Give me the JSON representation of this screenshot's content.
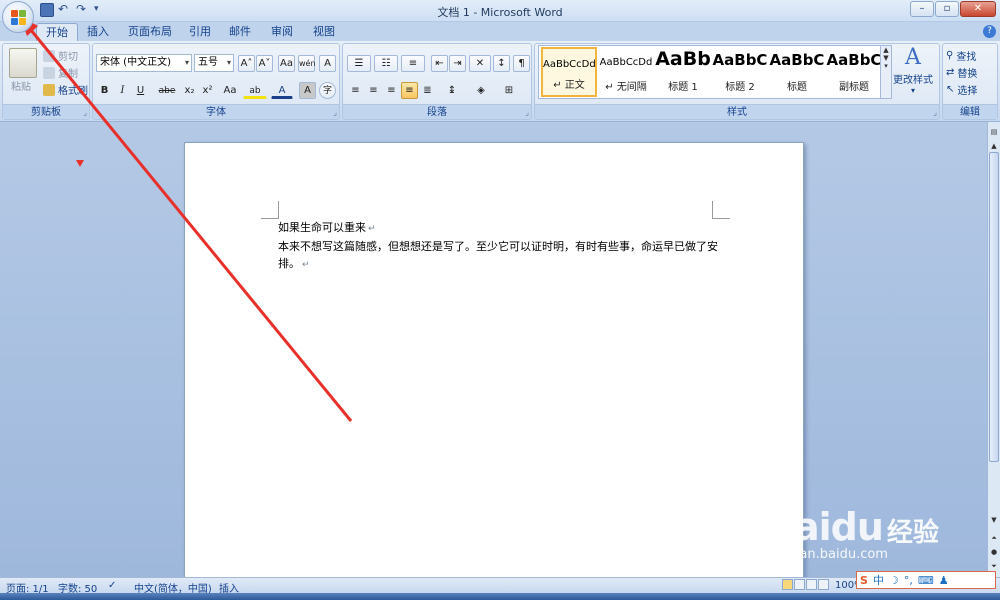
{
  "window": {
    "title": "文档 1 - Microsoft Word",
    "controls": {
      "minimize": "–",
      "restore": "▫",
      "close": "✕"
    }
  },
  "quick_access": {
    "save_icon": "save-icon",
    "undo_icon": "undo-icon",
    "redo_icon": "redo-icon",
    "more": "▾"
  },
  "tabs": [
    "开始",
    "插入",
    "页面布局",
    "引用",
    "邮件",
    "审阅",
    "视图"
  ],
  "active_tab": "开始",
  "ribbon": {
    "clipboard": {
      "label": "剪贴板",
      "paste": "粘贴",
      "cut": "剪切",
      "copy": "复制",
      "format_painter": "格式刷"
    },
    "font": {
      "label": "字体",
      "font_name": "宋体 (中文正文)",
      "font_size": "五号",
      "buttons_row1": [
        "A˄",
        "A˅",
        "Aa",
        "wén",
        "A"
      ],
      "bold": "B",
      "italic": "I",
      "underline": "U",
      "strike": "abe",
      "subscript": "x₂",
      "superscript": "x²",
      "change_case": "Aa",
      "highlight": "ab",
      "font_color": "A",
      "char_shading": "A",
      "enclose": "字"
    },
    "paragraph": {
      "label": "段落"
    },
    "styles": {
      "label": "样式",
      "items": [
        {
          "sample": "AaBbCcDd",
          "name": "↵ 正文"
        },
        {
          "sample": "AaBbCcDd",
          "name": "↵ 无间隔"
        },
        {
          "sample": "AaBb",
          "name": "标题 1"
        },
        {
          "sample": "AaBbC",
          "name": "标题 2"
        },
        {
          "sample": "AaBbC",
          "name": "标题"
        },
        {
          "sample": "AaBbC",
          "name": "副标题"
        }
      ],
      "change_styles": "更改样式"
    },
    "editing": {
      "label": "编辑",
      "find": "查找",
      "replace": "替换",
      "select": "选择"
    }
  },
  "document": {
    "line1": "如果生命可以重来",
    "line2": "本来不想写这篇随感，但想想还是写了。至少它可以证时明，有时有些事，命运早已做了安",
    "line3": "排。"
  },
  "status": {
    "page": "页面: 1/1",
    "words": "字数: 50",
    "language": "中文(简体，中国)",
    "mode": "插入",
    "zoom": "100%"
  },
  "ime": {
    "logo": "S",
    "mode": "中"
  },
  "watermark": {
    "brand": "Baidu",
    "brand_cn": "经验",
    "url": "jingyan.baidu.com"
  },
  "colors": {
    "accent": "#15428b",
    "arrow": "#e8302a",
    "office_orange": "#f1b53c"
  }
}
